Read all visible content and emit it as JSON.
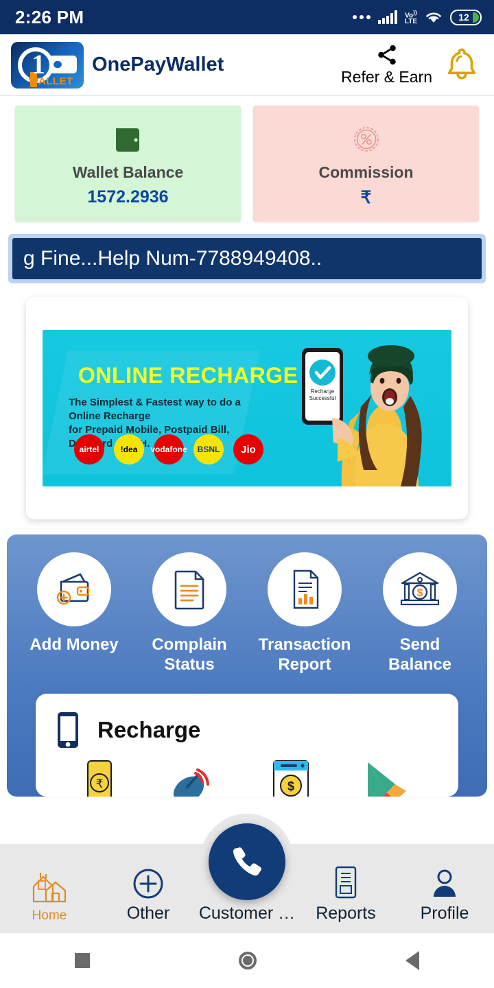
{
  "status_bar": {
    "time": "2:26 PM",
    "network_type": "VoLTE",
    "battery_level": "12",
    "icons": [
      "more-dots-icon",
      "signal-bars-icon",
      "volte-icon",
      "wifi-icon",
      "battery-icon"
    ]
  },
  "header": {
    "app_title": "OnePayWallet",
    "logo_digit": "1",
    "logo_wordmark": "WALLET",
    "refer_label": "Refer & Earn",
    "share_icon": "share-icon",
    "bell_icon": "notification-bell-icon"
  },
  "balance_cards": [
    {
      "label": "Wallet Balance",
      "value": "1572.2936",
      "icon": "wallet-icon",
      "bg_color": "#d4f5d6",
      "icon_color": "#2f6b31",
      "value_color": "#0d47a1"
    },
    {
      "label": "Commission",
      "value": "₹",
      "icon": "percent-badge-icon",
      "bg_color": "#fbd9d5",
      "icon_color": "#e8928a",
      "value_color": "#0d47a1"
    }
  ],
  "ticker": {
    "text": "g Fine...Help Num-7788949408..",
    "bg_color": "#10356b",
    "border_color": "#bcd3f0"
  },
  "promo_banner": {
    "title": "ONLINE RECHARGE",
    "subtitle_line1": "The Simplest & Fastest way to do a Online Recharge",
    "subtitle_line2": "for Prepaid Mobile, Postpaid Bill, Datacard & DTH.",
    "bg_color": "#0fc3dd",
    "title_color": "#f2ff24",
    "phone_caption_line1": "Recharge",
    "phone_caption_line2": "Successful",
    "brand_logos": [
      {
        "name": "airtel",
        "label": "airtel"
      },
      {
        "name": "idea",
        "label": "!dea"
      },
      {
        "name": "vodafone",
        "label": "vodafone"
      },
      {
        "name": "bsnl",
        "label": "BSNL"
      },
      {
        "name": "jio",
        "label": "Jio"
      }
    ]
  },
  "quick_actions": [
    {
      "label": "Add Money",
      "icon": "wallet-plus-icon"
    },
    {
      "label": "Complain Status",
      "icon": "document-lines-icon"
    },
    {
      "label": "Transaction Report",
      "icon": "report-chart-icon"
    },
    {
      "label": "Send Balance",
      "icon": "bank-icon"
    }
  ],
  "recharge_section": {
    "title": "Recharge",
    "icon": "mobile-phone-icon",
    "services": [
      {
        "name": "mobile-recharge-icon"
      },
      {
        "name": "dth-dish-icon"
      },
      {
        "name": "money-transfer-icon"
      },
      {
        "name": "google-play-icon"
      }
    ]
  },
  "floating_button": {
    "icon": "phone-call-icon",
    "color": "#123c78"
  },
  "bottom_nav": [
    {
      "label": "Home",
      "icon": "home-icon",
      "active": true
    },
    {
      "label": "Other",
      "icon": "plus-circle-icon",
      "active": false
    },
    {
      "label": "Customer …",
      "icon": "customer-care-icon",
      "active": false
    },
    {
      "label": "Reports",
      "icon": "reports-document-icon",
      "active": false
    },
    {
      "label": "Profile",
      "icon": "person-icon",
      "active": false
    }
  ],
  "system_nav": [
    {
      "name": "recents-square-icon"
    },
    {
      "name": "home-circle-icon"
    },
    {
      "name": "back-triangle-icon"
    }
  ]
}
